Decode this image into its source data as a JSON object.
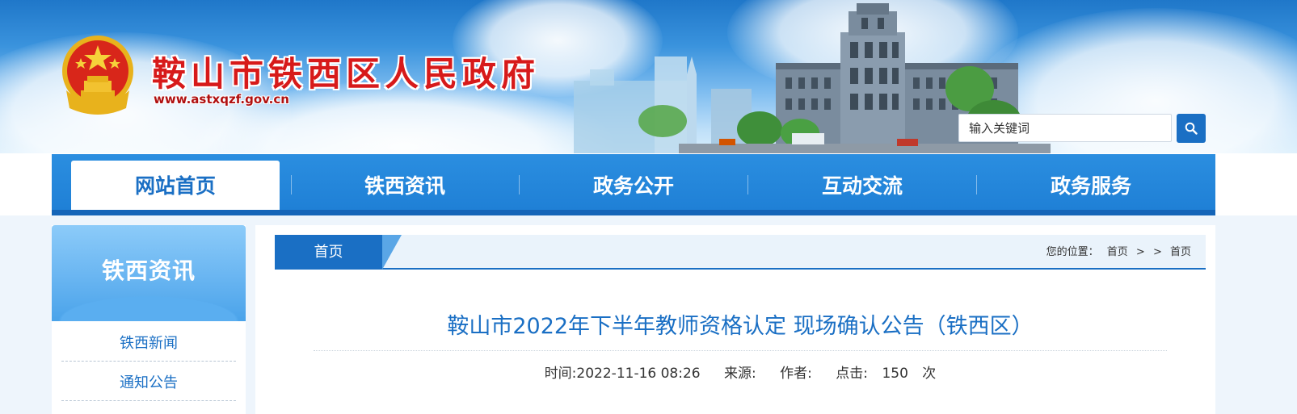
{
  "header": {
    "site_title": "鞍山市铁西区人民政府",
    "site_url": "www.astxqzf.gov.cn",
    "emblem_icon": "national-emblem-icon",
    "search": {
      "placeholder": "输入关键词",
      "value": "输入关键词",
      "button_icon": "search-icon"
    }
  },
  "nav": {
    "items": [
      {
        "label": "网站首页",
        "active": true
      },
      {
        "label": "铁西资讯",
        "active": false
      },
      {
        "label": "政务公开",
        "active": false
      },
      {
        "label": "互动交流",
        "active": false
      },
      {
        "label": "政务服务",
        "active": false
      }
    ]
  },
  "sidebar": {
    "title": "铁西资讯",
    "links": [
      {
        "label": "铁西新闻"
      },
      {
        "label": "通知公告"
      }
    ]
  },
  "breadcrumb": {
    "tab_label": "首页",
    "prefix": "您的位置：",
    "path": [
      "首页",
      ">",
      ">",
      "首页"
    ]
  },
  "article": {
    "title": "鞍山市2022年下半年教师资格认定 现场确认公告（铁西区）",
    "meta": {
      "time": "时间:2022-11-16 08:26",
      "source_label": "来源:",
      "author_label": "作者:",
      "clicks_label": "点击:",
      "clicks_value": "150",
      "clicks_unit": "次"
    }
  },
  "colors": {
    "brand_blue": "#1a6fc4",
    "nav_blue": "#1f80d6",
    "title_red": "#d71a1a"
  }
}
